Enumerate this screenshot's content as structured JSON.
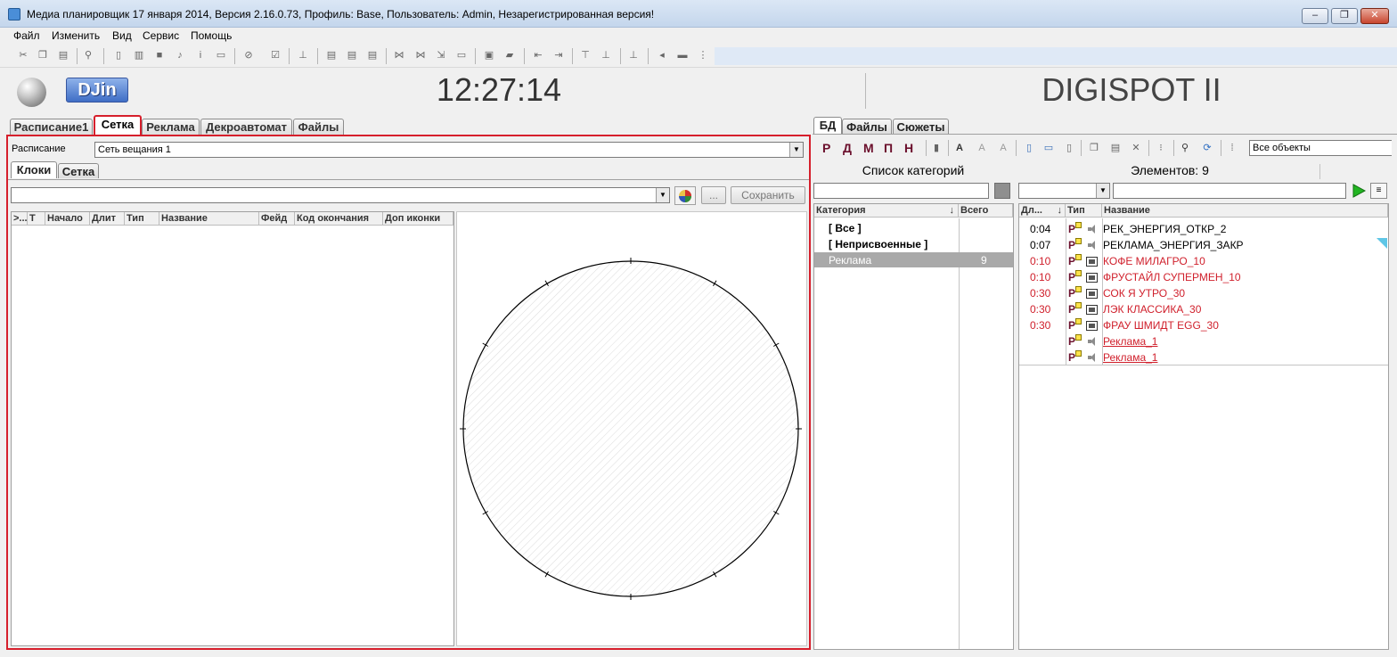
{
  "window": {
    "title": "Медиа планировщик 17 января 2014, Версия 2.16.0.73, Профиль: Base, Пользователь: Admin, Незарегистрированная версия!",
    "btn_min": "–",
    "btn_max": "❐",
    "btn_close": "✕"
  },
  "menu": [
    "Файл",
    "Изменить",
    "Вид",
    "Сервис",
    "Помощь"
  ],
  "header": {
    "logo": "DJin",
    "clock": "12:27:14",
    "brand": "DIGISPOT II"
  },
  "main_tabs": [
    "Расписание1",
    "Сетка",
    "Реклама",
    "Декроавтомат",
    "Файлы"
  ],
  "schedule": {
    "label": "Расписание",
    "value": "Сеть вещания 1"
  },
  "sub_tabs": [
    "Клоки",
    "Сетка"
  ],
  "grid_toolbar": {
    "combo_value": "",
    "dots_label": "...",
    "save_label": "Сохранить"
  },
  "grid_columns": [
    ">...",
    "Т",
    "Начало",
    "Длит",
    "Тип",
    "Название",
    "Фейд",
    "Код окончания",
    "Доп иконки"
  ],
  "right_tabs": [
    "БД",
    "Файлы",
    "Сюжеты"
  ],
  "right_toolbar": {
    "type_letters": [
      "Р",
      "Д",
      "М",
      "П",
      "Н"
    ],
    "filter_value": "Все объекты"
  },
  "categories": {
    "title": "Список категорий",
    "search_value": "",
    "col_category": "Категория",
    "col_total": "Всего",
    "items": [
      {
        "name": "[ Все ]",
        "total": ""
      },
      {
        "name": "[ Неприсвоенные ]",
        "total": ""
      },
      {
        "name": "Реклама",
        "total": "9"
      }
    ]
  },
  "elements": {
    "title": "Элементов: 9",
    "col_duration": "Дл...",
    "col_type": "Тип",
    "col_name": "Название",
    "items": [
      {
        "duration": "0:04",
        "type": "Р",
        "media": "audio",
        "name": "РЕК_ЭНЕРГИЯ_ОТКР_2",
        "color": "#000000"
      },
      {
        "duration": "0:07",
        "type": "Р",
        "media": "audio",
        "name": "РЕКЛАМА_ЭНЕРГИЯ_ЗАКР",
        "color": "#000000"
      },
      {
        "duration": "0:10",
        "type": "Р",
        "media": "video",
        "name": "КОФЕ МИЛАГРО_10",
        "color": "#d0202c"
      },
      {
        "duration": "0:10",
        "type": "Р",
        "media": "video",
        "name": "ФРУСТАЙЛ СУПЕРМЕН_10",
        "color": "#d0202c"
      },
      {
        "duration": "0:30",
        "type": "Р",
        "media": "video",
        "name": "СОК Я УТРО_30",
        "color": "#d0202c"
      },
      {
        "duration": "0:30",
        "type": "Р",
        "media": "video",
        "name": "ЛЭК КЛАССИКА_30",
        "color": "#d0202c"
      },
      {
        "duration": "0:30",
        "type": "Р",
        "media": "video",
        "name": "ФРАУ ШМИДТ EGG_30",
        "color": "#d0202c"
      },
      {
        "duration": "",
        "type": "Р",
        "media": "audio",
        "name": "Реклама_1",
        "color": "#d0202c"
      },
      {
        "duration": "",
        "type": "Р",
        "media": "audio",
        "name": "Реклама_1",
        "color": "#d0202c"
      }
    ]
  }
}
